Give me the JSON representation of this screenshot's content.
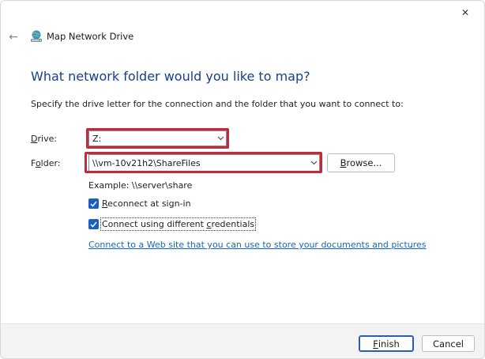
{
  "window": {
    "title": "Map Network Drive",
    "close_symbol": "✕",
    "back_symbol": "←",
    "icons": {
      "app": "network-drive-icon",
      "close": "close-icon",
      "back": "back-arrow-icon"
    }
  },
  "heading": "What network folder would you like to map?",
  "description": "Specify the drive letter for the connection and the folder that you want to connect to:",
  "drive": {
    "label_prefix": "",
    "label_mnemonic": "D",
    "label_rest": "rive:",
    "value": "Z:"
  },
  "folder": {
    "label_prefix": "F",
    "label_mnemonic": "o",
    "label_rest": "lder:",
    "value": "\\\\vm-10v21h2\\ShareFiles"
  },
  "browse": {
    "mnemonic": "B",
    "rest": "rowse..."
  },
  "example": "Example: \\\\server\\share",
  "reconnect": {
    "mnemonic": "R",
    "rest": "econnect at sign-in",
    "checked": true
  },
  "credentials": {
    "prefix": "Connect using different ",
    "mnemonic": "c",
    "rest": "redentials",
    "checked": true
  },
  "web_link": {
    "text": "Connect to a Web site that you can use to store your documents and pictures",
    "tail": "."
  },
  "footer": {
    "finish": {
      "prefix": "",
      "mnemonic": "F",
      "rest": "inish"
    },
    "cancel": "Cancel"
  },
  "colors": {
    "heading": "#1a3e8c",
    "highlight": "#c4283a",
    "checkbox": "#1d5fbf",
    "link": "#1568b8"
  }
}
